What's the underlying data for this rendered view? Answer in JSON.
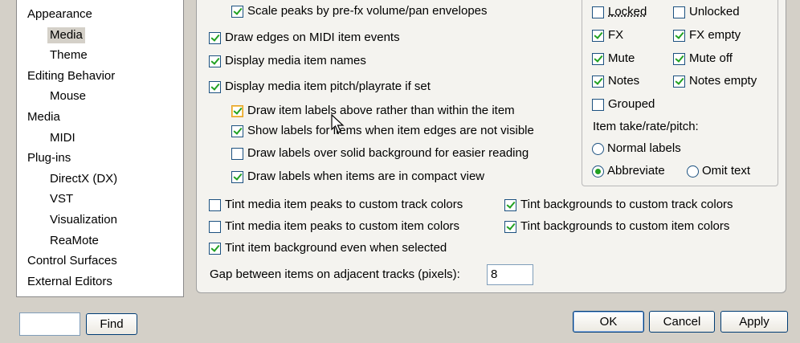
{
  "tree": [
    {
      "label": "Appearance",
      "indent": 0
    },
    {
      "label": "Media",
      "indent": 1,
      "selected": true
    },
    {
      "label": "Theme",
      "indent": 1
    },
    {
      "label": "Editing Behavior",
      "indent": 0
    },
    {
      "label": "Mouse",
      "indent": 1
    },
    {
      "label": "Media",
      "indent": 0
    },
    {
      "label": "MIDI",
      "indent": 1
    },
    {
      "label": "Plug-ins",
      "indent": 0
    },
    {
      "label": "DirectX (DX)",
      "indent": 1
    },
    {
      "label": "VST",
      "indent": 1
    },
    {
      "label": "Visualization",
      "indent": 1
    },
    {
      "label": "ReaMote",
      "indent": 1
    },
    {
      "label": "Control Surfaces",
      "indent": 0
    },
    {
      "label": "External Editors",
      "indent": 0
    }
  ],
  "options": {
    "scale_peaks": {
      "label": "Scale peaks by pre-fx volume/pan envelopes",
      "checked": true
    },
    "draw_edges_midi": {
      "label": "Draw edges on MIDI item events",
      "checked": true
    },
    "display_names": {
      "label": "Display media item names",
      "checked": true
    },
    "display_pitch": {
      "label": "Display media item pitch/playrate if set",
      "checked": true
    },
    "labels_above": {
      "label": "Draw item labels above rather than within the item",
      "checked": true
    },
    "show_labels_edges": {
      "label": "Show labels for items when item edges are not visible",
      "checked": true
    },
    "labels_solid_bg": {
      "label": "Draw labels over solid background for easier reading",
      "checked": false
    },
    "labels_compact": {
      "label": "Draw labels when items are in compact view",
      "checked": true
    },
    "tint_peaks_track": {
      "label": "Tint media item peaks to custom track colors",
      "checked": false
    },
    "tint_peaks_item": {
      "label": "Tint media item peaks to custom item colors",
      "checked": false
    },
    "tint_bg_track": {
      "label": "Tint backgrounds to custom track colors",
      "checked": true
    },
    "tint_bg_item": {
      "label": "Tint backgrounds to custom item colors",
      "checked": true
    },
    "tint_selected": {
      "label": "Tint item background even when selected",
      "checked": true
    }
  },
  "gap": {
    "label": "Gap between items on adjacent tracks (pixels):",
    "value": "8"
  },
  "icons_group": {
    "locked": {
      "label": "Locked",
      "checked": false
    },
    "unlocked": {
      "label": "Unlocked",
      "checked": false
    },
    "fx": {
      "label": "FX",
      "checked": true
    },
    "fx_empty": {
      "label": "FX empty",
      "checked": true
    },
    "mute": {
      "label": "Mute",
      "checked": true
    },
    "mute_off": {
      "label": "Mute off",
      "checked": true
    },
    "notes": {
      "label": "Notes",
      "checked": true
    },
    "notes_empty": {
      "label": "Notes empty",
      "checked": true
    },
    "grouped": {
      "label": "Grouped",
      "checked": false
    },
    "take_title": "Item take/rate/pitch:",
    "normal_labels": {
      "label": "Normal labels",
      "selected": false
    },
    "abbreviate": {
      "label": "Abbreviate",
      "selected": true
    },
    "omit_text": {
      "label": "Omit text",
      "selected": false
    }
  },
  "footer": {
    "find_value": "",
    "find_label": "Find",
    "ok_label": "OK",
    "cancel_label": "Cancel",
    "apply_label": "Apply"
  }
}
